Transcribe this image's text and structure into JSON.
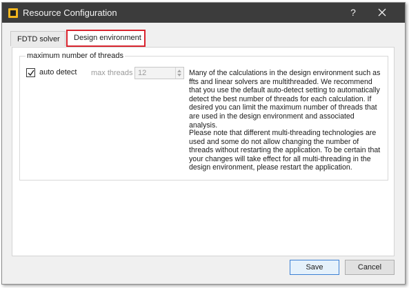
{
  "window": {
    "title": "Resource Configuration",
    "help_label": "?",
    "accent_color": "#d9232d",
    "icon_color": "#f2b51d"
  },
  "tabs": [
    {
      "label": "FDTD solver",
      "active": false
    },
    {
      "label": "Design environment",
      "active": true
    }
  ],
  "threads_group": {
    "label": "maximum number of threads",
    "auto_detect_label": "auto detect",
    "auto_detect_checked": true,
    "max_threads_label": "max threads",
    "max_threads_value": "12"
  },
  "description": {
    "paragraph1": "Many of the calculations in the design environment such as ffts and linear solvers are multithreaded. We recommend that you use the default auto-detect setting to automatically detect the best number of threads for each calculation. If desired you can limit the maximum number of threads that are used in the design environment and associated analysis.",
    "paragraph2": "Please note that different multi-threading technologies are used and some do not allow changing the number of threads without restarting the application. To be certain that your changes will take effect for all multi-threading in the design environment, please restart the application."
  },
  "buttons": {
    "save_label": "Save",
    "cancel_label": "Cancel"
  }
}
